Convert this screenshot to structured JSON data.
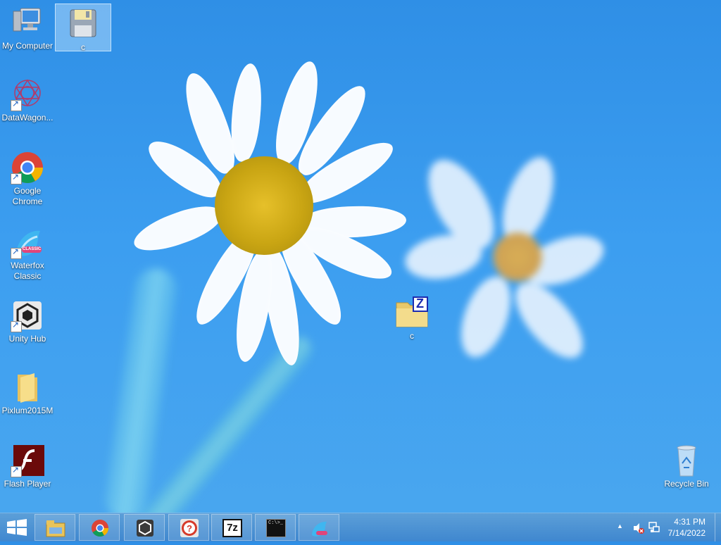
{
  "desktop": {
    "icons": [
      {
        "label": "My Computer"
      },
      {
        "label": "c"
      },
      {
        "label": "DataWagon..."
      },
      {
        "label": "Google Chrome"
      },
      {
        "label": "Waterfox Classic"
      },
      {
        "label": "Unity Hub"
      },
      {
        "label": "Pixlum2015M"
      },
      {
        "label": "Flash Player"
      },
      {
        "label": "c"
      },
      {
        "label": "Recycle Bin"
      }
    ],
    "badge_classic": "CLASSIC",
    "zip_letter": "Z"
  },
  "taskbar": {
    "items": [
      {
        "name": "file-explorer"
      },
      {
        "name": "google-chrome"
      },
      {
        "name": "unity-hub"
      },
      {
        "name": "help"
      },
      {
        "name": "7-zip",
        "text": "7z"
      },
      {
        "name": "command-prompt",
        "text": "C:\\>_"
      },
      {
        "name": "waterfox-classic"
      }
    ],
    "clock": {
      "time": "4:31 PM",
      "date": "7/14/2022"
    }
  }
}
